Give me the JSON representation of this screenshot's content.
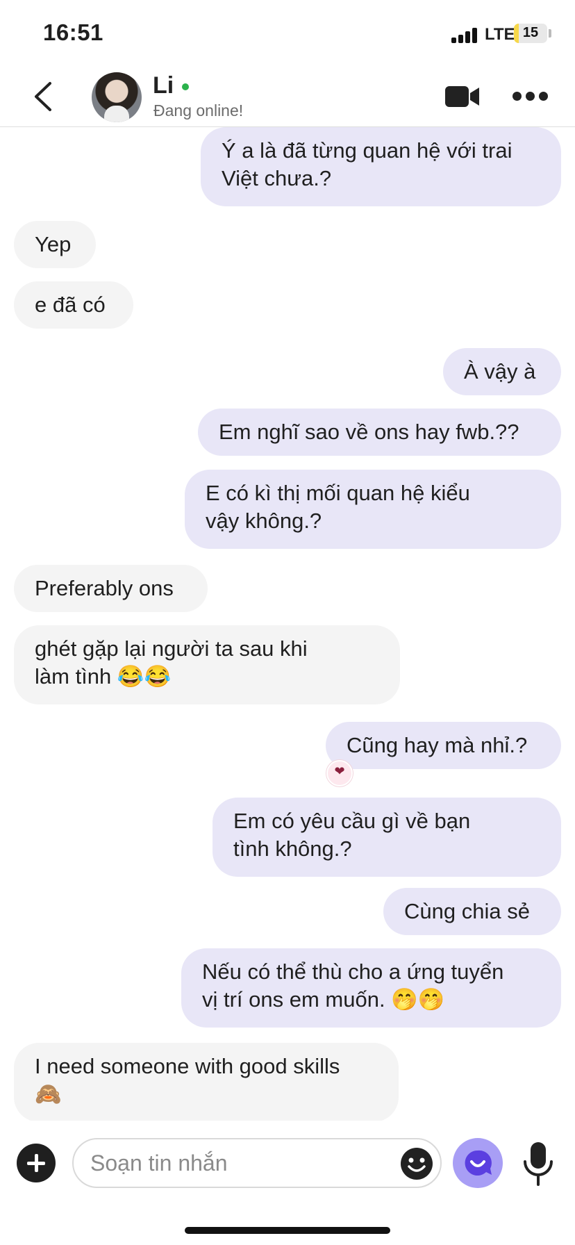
{
  "status_bar": {
    "time": "16:51",
    "network": "LTE",
    "battery": "15",
    "battery_level": 0.15
  },
  "header": {
    "back_icon": "chevron-left-icon",
    "contact_name": "Li",
    "contact_status": "Đang online!",
    "video_icon": "video-camera-icon",
    "more_icon": "more-horizontal-icon"
  },
  "messages": [
    {
      "side": "sent",
      "text": "Ý a là đã từng quan hệ với trai\nViệt chưa.?"
    },
    {
      "side": "received",
      "text": "Yep"
    },
    {
      "side": "received",
      "text": "e đã có"
    },
    {
      "side": "sent",
      "text": "À vậy à"
    },
    {
      "side": "sent",
      "text": "Em nghĩ sao về ons hay fwb.??"
    },
    {
      "side": "sent",
      "text": "E có kì thị mối quan hệ kiểu\nvậy không.?"
    },
    {
      "side": "received",
      "text": "Preferably ons"
    },
    {
      "side": "received",
      "text": "ghét gặp lại người ta sau khi\nlàm tình 😂😂"
    },
    {
      "side": "sent",
      "text": "Cũng hay mà nhỉ.?",
      "reaction": "heart"
    },
    {
      "side": "sent",
      "text": "Em có yêu cầu gì về bạn\ntình không.?"
    },
    {
      "side": "sent",
      "text": "Cùng chia sẻ"
    },
    {
      "side": "sent",
      "text": "Nếu có thể thù cho a ứng tuyển\nvị trí ons em muốn. 🤭🤭"
    },
    {
      "side": "received",
      "text": "I need someone with good skills\n🙈"
    }
  ],
  "composer": {
    "placeholder": "Soạn tin nhắn",
    "plus_icon": "plus-icon",
    "emoji_icon": "emoji-icon",
    "ai_icon": "ai-chat-icon",
    "mic_icon": "microphone-icon"
  },
  "colors": {
    "sent_bubble": "#e8e6f7",
    "received_bubble": "#f4f4f4",
    "accent": "#a89ef5",
    "online": "#2bb24c"
  }
}
